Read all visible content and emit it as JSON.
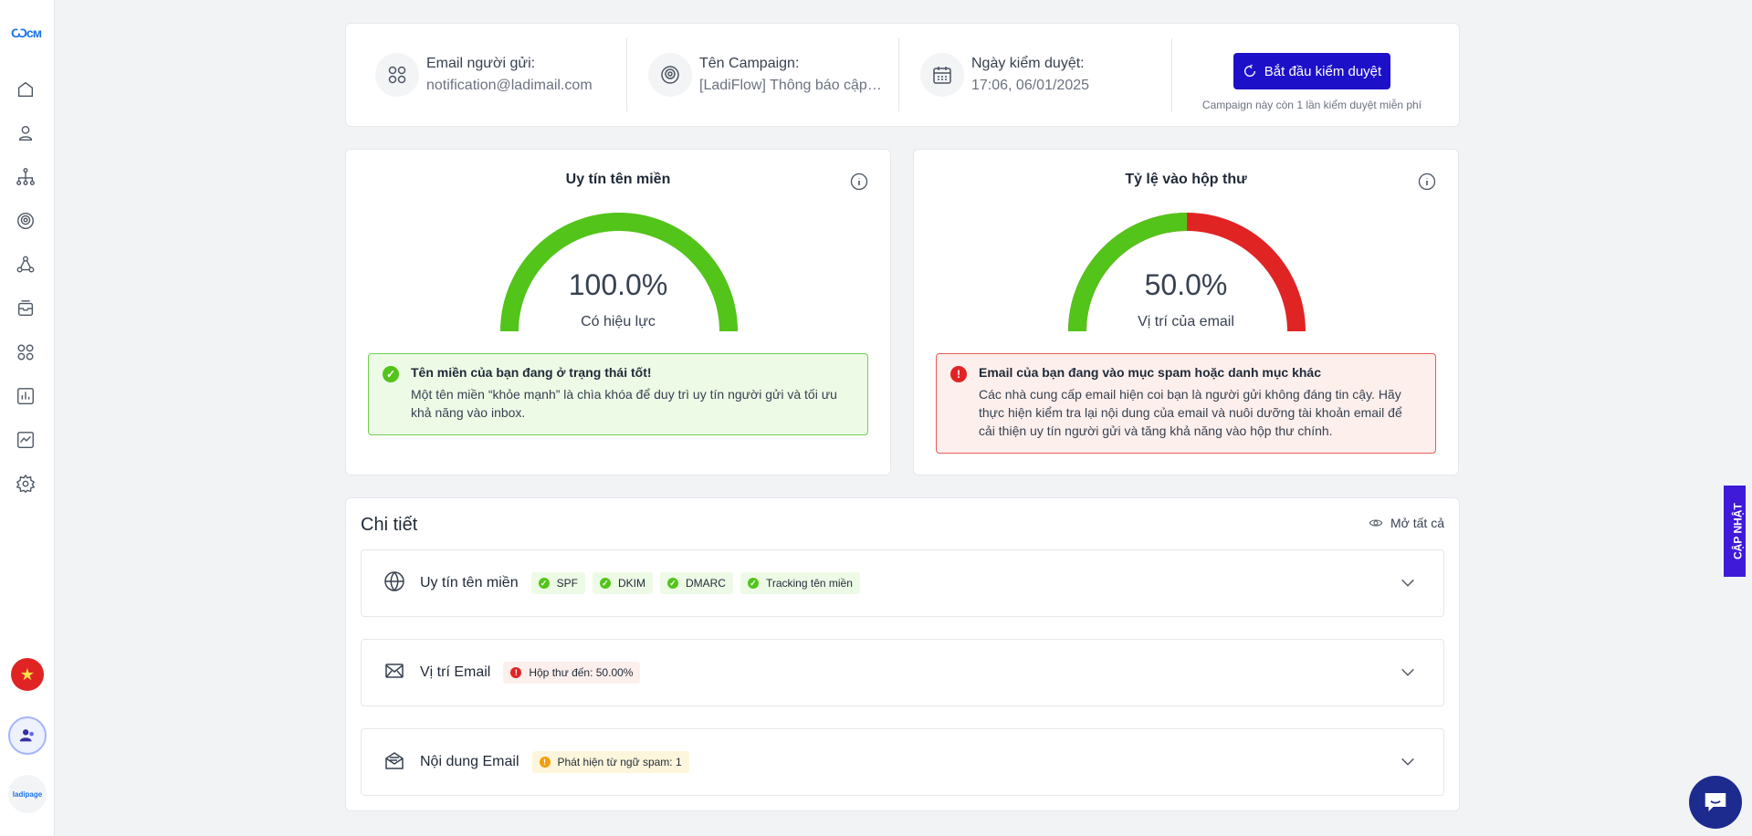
{
  "sidebar": {
    "logo_text": "Ѡсм",
    "icons": [
      "home-icon",
      "user-icon",
      "sitemap-icon",
      "campaign-icon",
      "flow-icon",
      "inbox-icon",
      "apps-icon",
      "report-icon",
      "chart-line-icon",
      "settings-icon"
    ],
    "ladipage_label": "ladipage",
    "flag_glyph": "★"
  },
  "header": {
    "sender_label": "Email người gửi:",
    "sender_value": "notification@ladimail.com",
    "campaign_label": "Tên Campaign:",
    "campaign_value": "[LadiFlow] Thông báo cập nhật",
    "date_label": "Ngày kiểm duyệt:",
    "date_value": "17:06, 06/01/2025",
    "start_button": "Bắt đầu kiểm duyệt",
    "start_note": "Campaign này còn 1 lần kiểm duyệt miễn phí"
  },
  "domain_reputation": {
    "title": "Uy tín tên miền",
    "value": "100.0%",
    "value_fraction": 1.0,
    "subtitle": "Có hiệu lực",
    "alert_title": "Tên miền của bạn đang ở trạng thái tốt!",
    "alert_text": "Một tên miền “khỏe mạnh” là chìa khóa để duy trì uy tín người gửi và tối ưu khả năng vào inbox."
  },
  "inbox_rate": {
    "title": "Tỷ lệ vào hộp thư",
    "value": "50.0%",
    "value_fraction": 0.5,
    "subtitle": "Vị trí của email",
    "alert_title": "Email của bạn đang vào mục spam hoặc danh mục khác",
    "alert_text": "Các nhà cung cấp email hiện coi bạn là người gửi không đáng tin cậy. Hãy thực hiện kiểm tra lại nội dung của email và nuôi dưỡng tài khoản email để cải thiện uy tín người gửi và tăng khả năng vào hộp thư chính."
  },
  "details": {
    "title": "Chi tiết",
    "open_all": "Mở tất cả",
    "rows": [
      {
        "title": "Uy tín tên miền",
        "tags": [
          "SPF",
          "DKIM",
          "DMARC",
          "Tracking tên miền"
        ]
      },
      {
        "title": "Vị trí Email",
        "tags": [
          "Hộp thư đến: 50.00%"
        ]
      },
      {
        "title": "Nội dung Email",
        "tags": [
          "Phát hiện từ ngữ spam: 1"
        ]
      }
    ]
  },
  "update_tab": "CẬP NHẬT",
  "colors": {
    "primary": "#1d10c9",
    "success": "#52c41a",
    "danger": "#e02424",
    "warning": "#f59e0b"
  }
}
